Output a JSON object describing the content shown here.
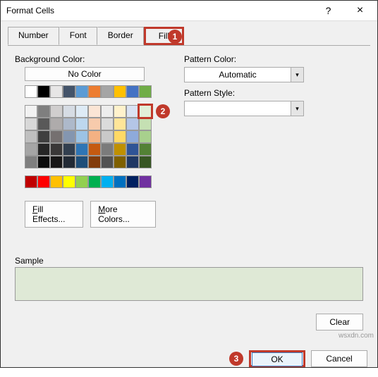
{
  "titlebar": {
    "title": "Format Cells",
    "help": "?",
    "close": "×"
  },
  "tabs": {
    "number": "Number",
    "font": "Font",
    "border": "Border",
    "fill": "Fill"
  },
  "left": {
    "bg_label": "Background Color:",
    "no_color": "No Color",
    "fill_effects": "Fill Effects...",
    "more_colors": "More Colors..."
  },
  "right": {
    "pattern_color_label": "Pattern Color:",
    "pattern_color_value": "Automatic",
    "pattern_style_label": "Pattern Style:"
  },
  "sample": {
    "label": "Sample"
  },
  "buttons": {
    "clear": "Clear",
    "ok": "OK",
    "cancel": "Cancel"
  },
  "annotations": {
    "a1": "1",
    "a2": "2",
    "a3": "3"
  },
  "watermark": "wsxdn.com",
  "colors": {
    "grid1": [
      [
        "#ffffff",
        "#000000",
        "#e7e6e6",
        "#44546a",
        "#5b9bd5",
        "#ed7d31",
        "#a5a5a5",
        "#ffc000",
        "#4472c4",
        "#70ad47"
      ]
    ],
    "grid2": [
      [
        "#f2f2f2",
        "#7f7f7f",
        "#d0cece",
        "#d6dce4",
        "#deebf6",
        "#fbe5d5",
        "#ededed",
        "#fff2cc",
        "#d9e2f3",
        "#e2efd9"
      ],
      [
        "#d8d8d8",
        "#595959",
        "#aeabab",
        "#adb9ca",
        "#bdd7ee",
        "#f7cbac",
        "#dbdbdb",
        "#fee599",
        "#b4c6e7",
        "#c5e0b3"
      ],
      [
        "#bfbfbf",
        "#3f3f3f",
        "#757070",
        "#8496b0",
        "#9cc3e5",
        "#f4b183",
        "#c9c9c9",
        "#ffd965",
        "#8eaadb",
        "#a8d08d"
      ],
      [
        "#a5a5a5",
        "#262626",
        "#3a3838",
        "#323f4f",
        "#2e75b5",
        "#c55a11",
        "#7b7b7b",
        "#bf9000",
        "#2f5496",
        "#538135"
      ],
      [
        "#7f7f7f",
        "#0c0c0c",
        "#171616",
        "#222a35",
        "#1e4e79",
        "#833c0b",
        "#525252",
        "#7f6000",
        "#1f3864",
        "#375623"
      ]
    ],
    "grid3": [
      [
        "#c00000",
        "#ff0000",
        "#ffc000",
        "#ffff00",
        "#92d050",
        "#00b050",
        "#00b0f0",
        "#0070c0",
        "#002060",
        "#7030a0"
      ]
    ]
  }
}
